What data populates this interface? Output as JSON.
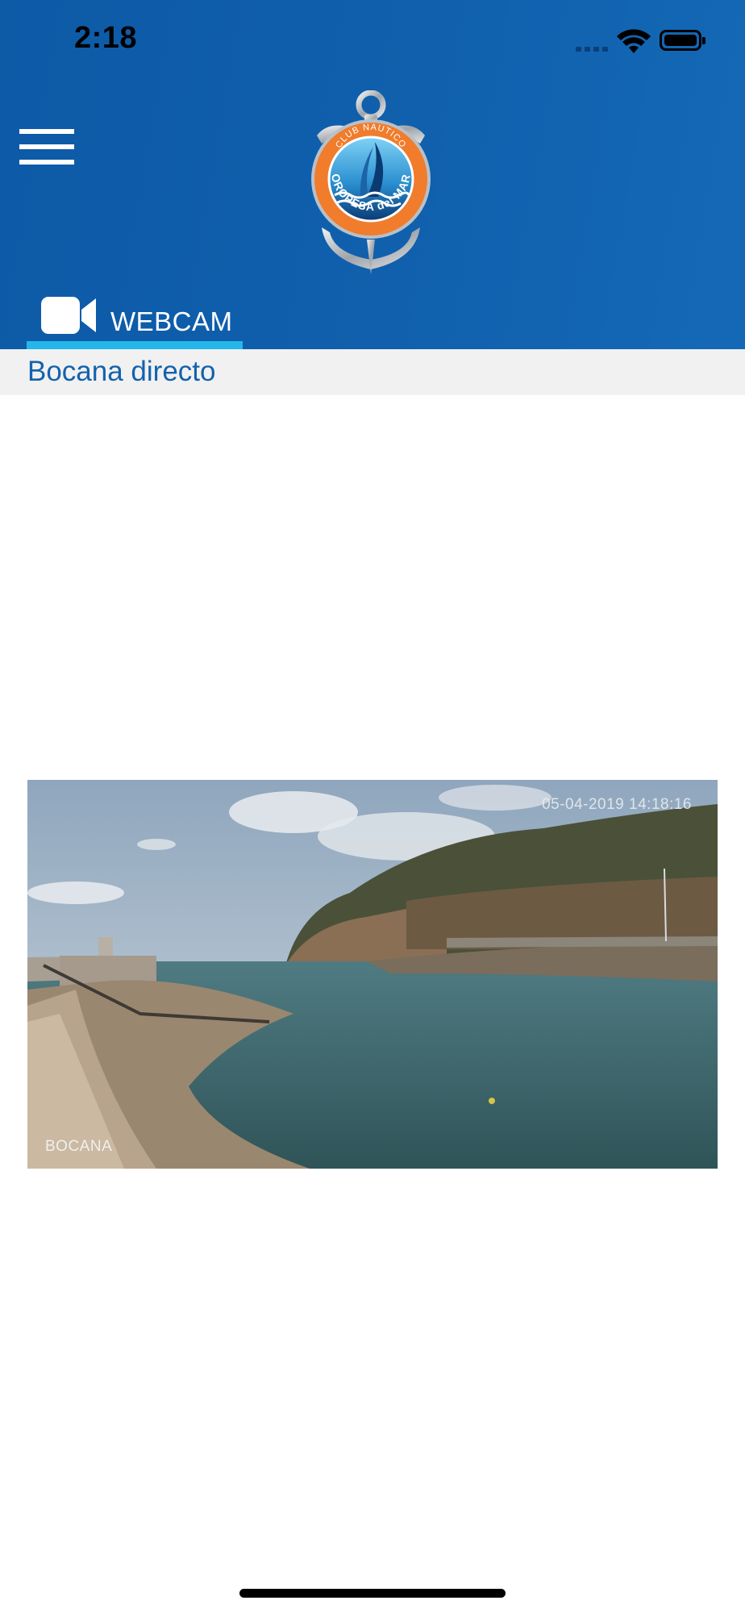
{
  "status_bar": {
    "time": "2:18",
    "icons": [
      "cellular-signal-icon",
      "wifi-icon",
      "battery-icon"
    ]
  },
  "header": {
    "menu_icon": "hamburger-menu-icon",
    "logo_text_top": "CLUB NAUTICO",
    "logo_text_bottom": "OROPESA del MAR",
    "background_color": "#1060ad"
  },
  "tabs": [
    {
      "icon": "video-camera-icon",
      "label": "WEBCAM",
      "active": true,
      "underline_color": "#25b6ea"
    }
  ],
  "section": {
    "title": "Bocana directo",
    "title_color": "#1462ad"
  },
  "webcam": {
    "timestamp": "05-04-2019 14:18:16",
    "camera_label": "BOCANA"
  }
}
